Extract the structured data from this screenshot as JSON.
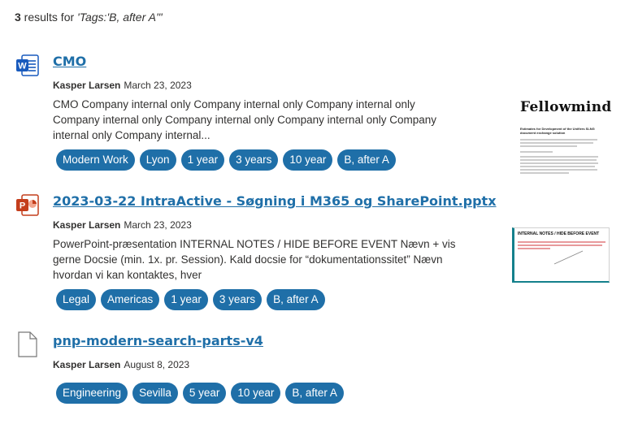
{
  "summary": {
    "count": "3",
    "text": " results for ",
    "query": "'Tags:'B, after A'\""
  },
  "results": [
    {
      "title": "CMO",
      "file_type": "word-icon",
      "author": "Kasper Larsen",
      "date": "March 23, 2023",
      "snippet": "CMO Company internal only Company internal only Company internal only Company internal only Company internal only Company internal only Company internal only Company internal...",
      "tags": [
        "Modern Work",
        "Lyon",
        "1 year",
        "3 years",
        "10 year",
        "B, after A"
      ],
      "thumbnail": {
        "logo": "Fellowmind",
        "heading": "Estimates for Development of the Unifiers SLNG document exchange solution"
      }
    },
    {
      "title": "2023-03-22 IntraActive - Søgning i M365 og SharePoint.pptx",
      "file_type": "powerpoint-icon",
      "author": "Kasper Larsen",
      "date": "March 23, 2023",
      "snippet": "PowerPoint-præsentation INTERNAL NOTES / HIDE BEFORE EVENT Nævn + vis gerne Docsie (min. 1x. pr. Session). Kald docsie for “dokumentationssitet” Nævn hvordan vi kan kontaktes, hver",
      "tags": [
        "Legal",
        "Americas",
        "1 year",
        "3 years",
        "B, after A"
      ],
      "thumbnail": {
        "heading": "INTERNAL NOTES / HIDE BEFORE EVENT"
      }
    },
    {
      "title": "pnp-modern-search-parts-v4",
      "file_type": "generic-file-icon",
      "author": "Kasper Larsen",
      "date": "August 8, 2023",
      "snippet": "",
      "tags": [
        "Engineering",
        "Sevilla",
        "5 year",
        "10 year",
        "B, after A"
      ]
    }
  ],
  "colors": {
    "accent": "#1f6fa8",
    "word": "#185abd",
    "powerpoint": "#c43e1c",
    "red_text": "#d13438"
  }
}
